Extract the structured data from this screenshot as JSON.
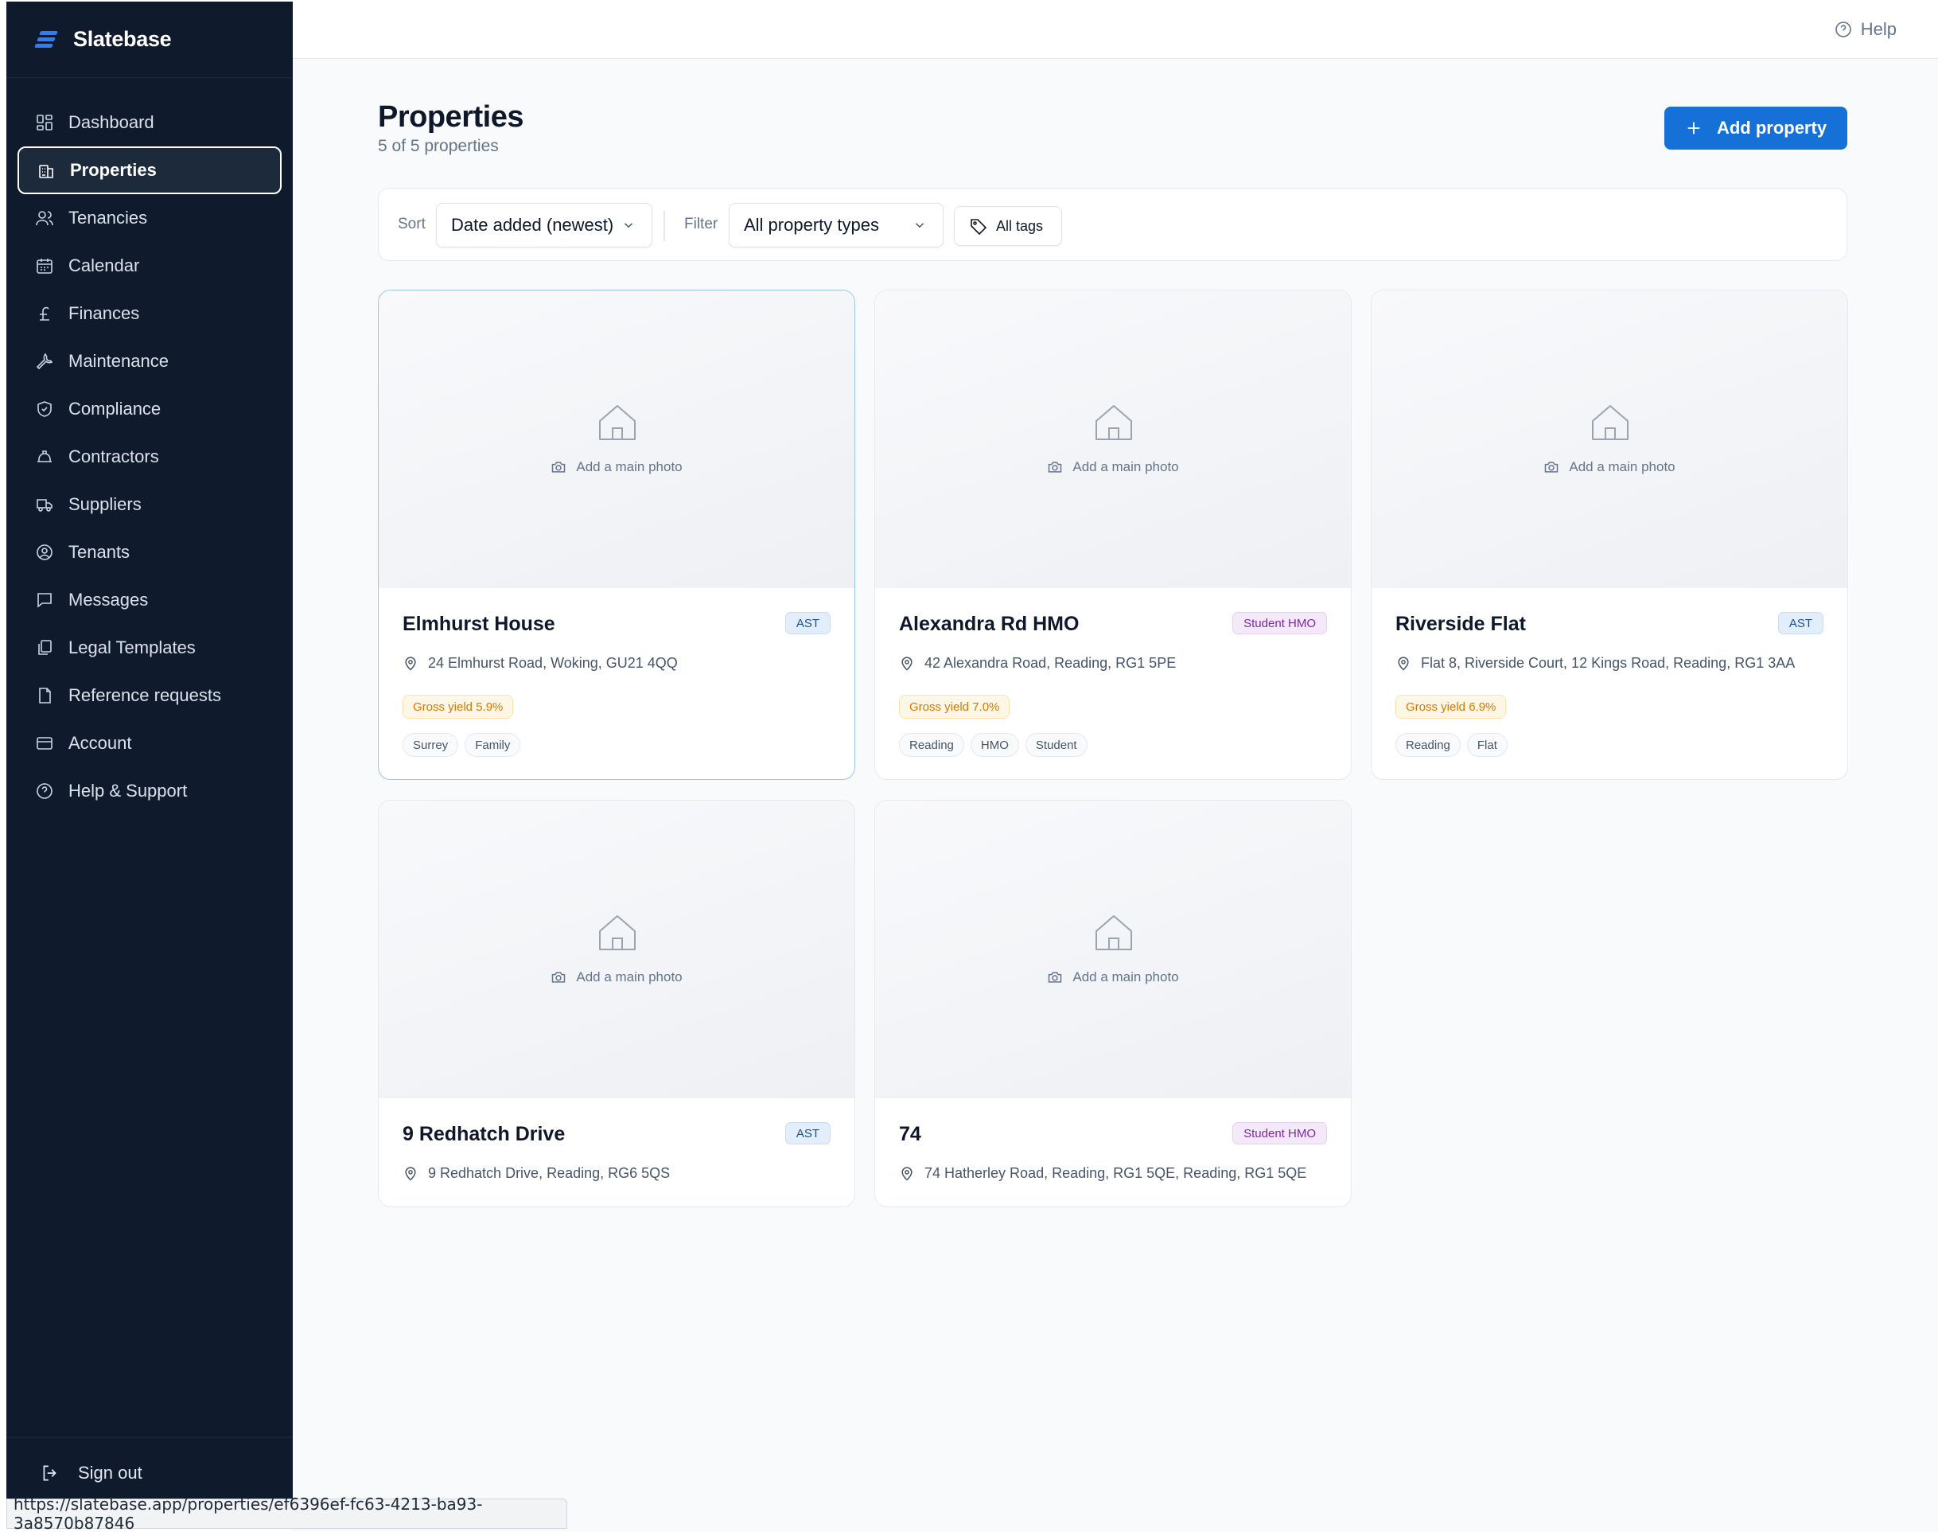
{
  "app": {
    "name": "Slatebase"
  },
  "sidebar": {
    "items": [
      {
        "label": "Dashboard",
        "icon": "dashboard-icon"
      },
      {
        "label": "Properties",
        "icon": "building-icon",
        "active": true
      },
      {
        "label": "Tenancies",
        "icon": "users-icon"
      },
      {
        "label": "Calendar",
        "icon": "calendar-icon"
      },
      {
        "label": "Finances",
        "icon": "pound-icon"
      },
      {
        "label": "Maintenance",
        "icon": "wrench-icon"
      },
      {
        "label": "Compliance",
        "icon": "shield-icon"
      },
      {
        "label": "Contractors",
        "icon": "hardhat-icon"
      },
      {
        "label": "Suppliers",
        "icon": "truck-icon"
      },
      {
        "label": "Tenants",
        "icon": "user-circle-icon"
      },
      {
        "label": "Messages",
        "icon": "message-icon"
      },
      {
        "label": "Legal Templates",
        "icon": "copy-icon"
      },
      {
        "label": "Reference requests",
        "icon": "document-icon"
      },
      {
        "label": "Account",
        "icon": "card-icon"
      },
      {
        "label": "Help & Support",
        "icon": "help-circle-icon"
      }
    ],
    "signout": "Sign out"
  },
  "topbar": {
    "help": "Help"
  },
  "page": {
    "title": "Properties",
    "subtitle": "5 of 5 properties",
    "add_button": "Add property"
  },
  "toolbar": {
    "sort_label": "Sort",
    "sort_value": "Date added (newest)",
    "filter_label": "Filter",
    "filter_value": "All property types",
    "tags_button": "All tags"
  },
  "photo_cta": "Add a main photo",
  "properties": [
    {
      "name": "Elmhurst House",
      "type": "AST",
      "address": "24 Elmhurst Road, Woking, GU21 4QQ",
      "yield": "Gross yield 5.9%",
      "tags": [
        "Surrey",
        "Family"
      ]
    },
    {
      "name": "Alexandra Rd HMO",
      "type": "Student HMO",
      "address": "42 Alexandra Road, Reading, RG1 5PE",
      "yield": "Gross yield 7.0%",
      "tags": [
        "Reading",
        "HMO",
        "Student"
      ]
    },
    {
      "name": "Riverside Flat",
      "type": "AST",
      "address": "Flat 8, Riverside Court, 12 Kings Road, Reading, RG1 3AA",
      "yield": "Gross yield 6.9%",
      "tags": [
        "Reading",
        "Flat"
      ]
    },
    {
      "name": "9 Redhatch Drive",
      "type": "AST",
      "address": "9 Redhatch Drive, Reading, RG6 5QS"
    },
    {
      "name": "74",
      "type": "Student HMO",
      "address": "74 Hatherley Road, Reading, RG1 5QE, Reading, RG1 5QE"
    }
  ],
  "statusbar": {
    "url": "https://slatebase.app/properties/ef6396ef-fc63-4213-ba93-3a8570b87846"
  },
  "colors": {
    "sidebar_bg": "#0f1b2d",
    "accent": "#1570d8",
    "yield": "#d97706"
  }
}
